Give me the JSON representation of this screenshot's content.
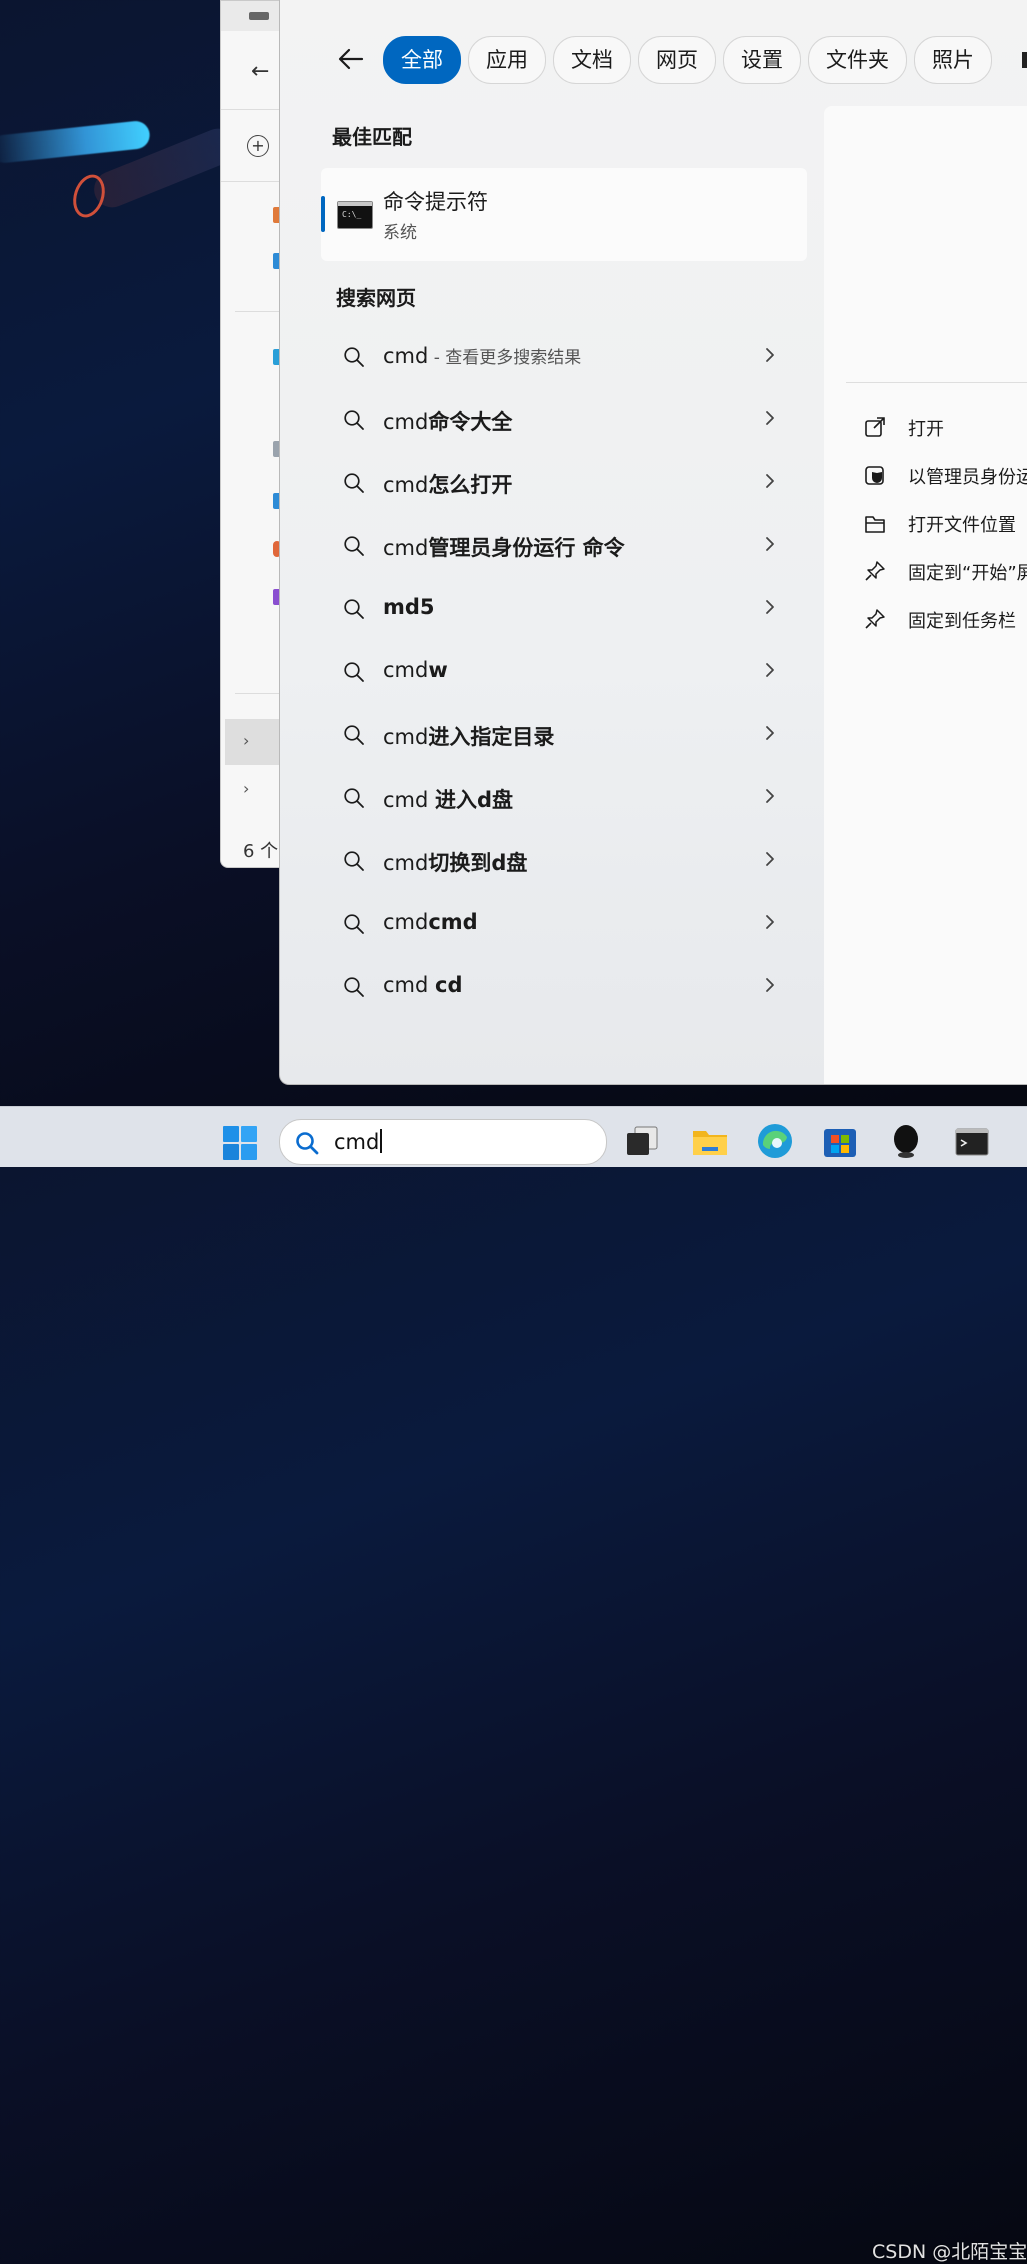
{
  "explorer": {
    "status_count": "6 个"
  },
  "filters": [
    "全部",
    "应用",
    "文档",
    "网页",
    "设置",
    "文件夹",
    "照片"
  ],
  "best_match": {
    "title": "最佳匹配",
    "app_name": "命令提示符",
    "app_type": "系统",
    "icon_text": "C:\\_"
  },
  "web_search": {
    "title": "搜索网页",
    "items": [
      {
        "prefix": "cmd",
        "bold": "",
        "suffix": " - 查看更多搜索结果"
      },
      {
        "prefix": "cmd",
        "bold": "命令大全",
        "suffix": ""
      },
      {
        "prefix": "cmd",
        "bold": "怎么打开",
        "suffix": ""
      },
      {
        "prefix": "cmd",
        "bold": "管理员身份运行 命令",
        "suffix": ""
      },
      {
        "prefix": "",
        "bold": "md5",
        "suffix": ""
      },
      {
        "prefix": "cmd",
        "bold": "w",
        "suffix": ""
      },
      {
        "prefix": "cmd",
        "bold": "进入指定目录",
        "suffix": ""
      },
      {
        "prefix": "cmd ",
        "bold": "进入d盘",
        "suffix": ""
      },
      {
        "prefix": "cmd",
        "bold": "切换到d盘",
        "suffix": ""
      },
      {
        "prefix": "cmd",
        "bold": "cmd",
        "suffix": ""
      },
      {
        "prefix": "cmd ",
        "bold": "cd",
        "suffix": ""
      }
    ]
  },
  "actions": [
    {
      "label": "打开",
      "icon": "open-external-icon"
    },
    {
      "label": "以管理员身份运",
      "icon": "admin-shield-icon"
    },
    {
      "label": "打开文件位置",
      "icon": "folder-icon"
    },
    {
      "label": "固定到“开始”屏",
      "icon": "pin-icon"
    },
    {
      "label": "固定到任务栏",
      "icon": "pin-icon"
    }
  ],
  "taskbar": {
    "search_value": "cmd",
    "watermark": "CSDN @北陌宝宝"
  },
  "colors": {
    "accent": "#0067c0"
  }
}
